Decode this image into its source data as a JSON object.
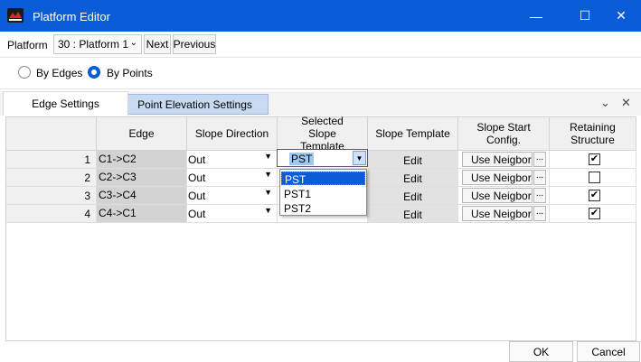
{
  "window": {
    "title": "Platform Editor",
    "controls": {
      "minimize": "—",
      "maximize": "☐",
      "close": "✕"
    }
  },
  "toolbar": {
    "platform_label": "Platform",
    "platform_value": "30 : Platform 1",
    "next_label": "Next",
    "previous_label": "Previous"
  },
  "mode": {
    "options": [
      {
        "label": "By Edges",
        "selected": false
      },
      {
        "label": "By Points",
        "selected": true
      }
    ]
  },
  "tabs": [
    {
      "label": "Edge Settings",
      "active": true
    },
    {
      "label": "Point Elevation Settings",
      "active": false
    }
  ],
  "tab_controls": {
    "dropdown": "⌄",
    "close": "✕"
  },
  "grid": {
    "columns": [
      "Edge",
      "Slope Direction",
      "Selected Slope Template",
      "Slope Template",
      "Slope Start Config.",
      "Retaining Structure"
    ],
    "rows": [
      {
        "num": "1",
        "edge": "C1->C2",
        "direction": "Out",
        "template": "PST",
        "template_action": "Edit",
        "start_config": "Use Neigbor",
        "start_more": "...",
        "retaining": true
      },
      {
        "num": "2",
        "edge": "C2->C3",
        "direction": "Out",
        "template": "",
        "template_action": "Edit",
        "start_config": "Use Neigbor",
        "start_more": "...",
        "retaining": false
      },
      {
        "num": "3",
        "edge": "C3->C4",
        "direction": "Out",
        "template": "",
        "template_action": "Edit",
        "start_config": "Use Neigbor",
        "start_more": "...",
        "retaining": true
      },
      {
        "num": "4",
        "edge": "C4->C1",
        "direction": "Out",
        "template": "",
        "template_action": "Edit",
        "start_config": "Use Neigbor",
        "start_more": "...",
        "retaining": true
      }
    ]
  },
  "template_dropdown": {
    "current": "PST",
    "options": [
      "PST",
      "PST1",
      "PST2"
    ],
    "highlighted": "PST"
  },
  "footer": {
    "ok_label": "OK",
    "cancel_label": "Cancel"
  },
  "colors": {
    "titlebar": "#0b5cd7",
    "accent": "#0b5cd7",
    "inactive_tab": "#c8daf2"
  }
}
